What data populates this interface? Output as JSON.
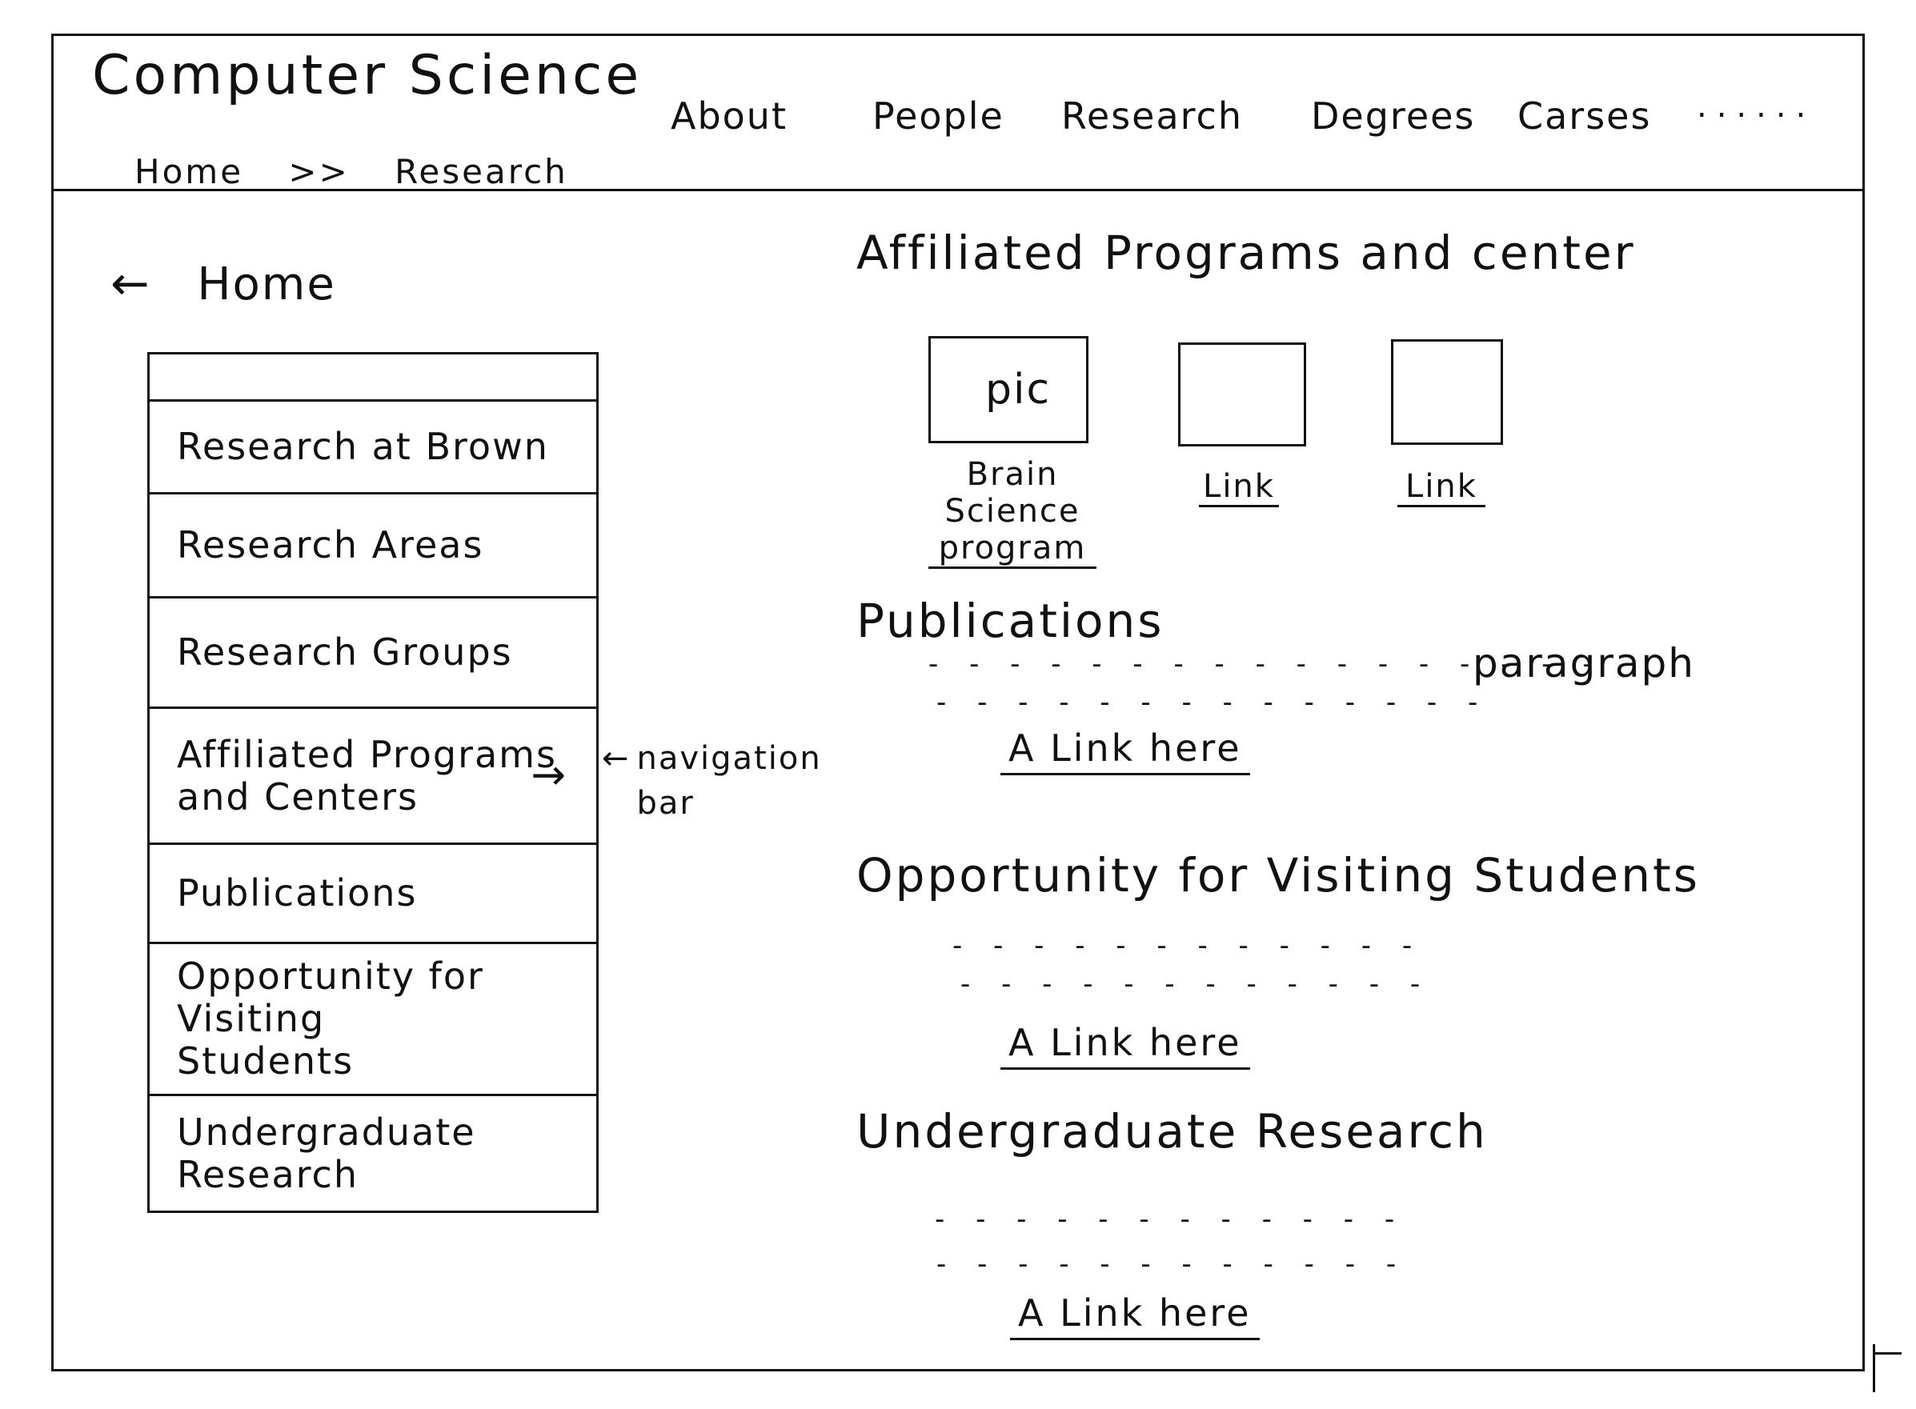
{
  "header": {
    "site_title": "Computer Science",
    "nav": [
      "About",
      "People",
      "Research",
      "Degrees",
      "Carses"
    ],
    "nav_more": "......",
    "breadcrumb": {
      "home": "Home",
      "separator": ">>",
      "current": "Research"
    }
  },
  "back_link": {
    "arrow": "←",
    "label": "Home"
  },
  "sidenav": {
    "items": [
      "",
      "Research at Brown",
      "Research Areas",
      "Research Groups",
      "Affiliated Programs\nand Centers",
      "Publications",
      "Opportunity for Visiting\nStudents",
      "Undergraduate Research"
    ],
    "active_arrow": "→"
  },
  "annotation": {
    "arrow": "←",
    "text": "navigation\nbar"
  },
  "content": {
    "affiliated": {
      "title": "Affiliated Programs and center",
      "cards": [
        {
          "pic": "pic",
          "link": "Brain Science\nprogram"
        },
        {
          "pic": "",
          "link": "Link"
        },
        {
          "pic": "",
          "link": "Link"
        }
      ]
    },
    "publications": {
      "title": "Publications",
      "paragraph_label": "paragraph",
      "link": "A Link here"
    },
    "visiting": {
      "title": "Opportunity for Visiting Students",
      "link": "A Link here"
    },
    "undergrad": {
      "title": "Undergraduate Research",
      "link": "A Link here"
    }
  }
}
